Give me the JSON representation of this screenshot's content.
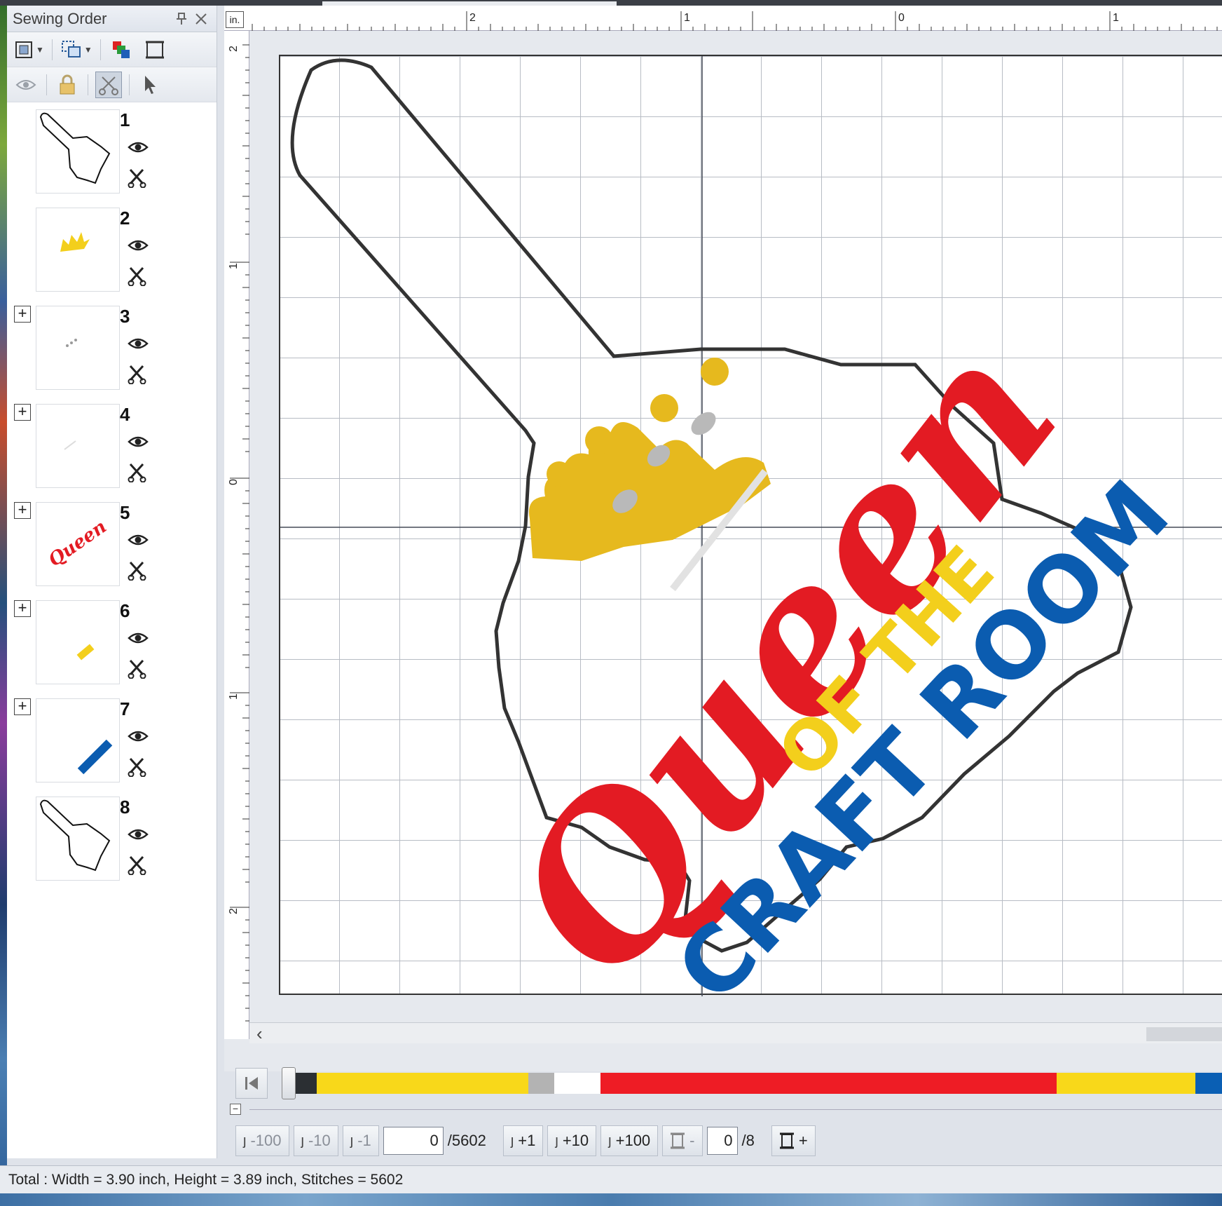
{
  "panel": {
    "title": "Sewing Order",
    "pin_icon": "pin-icon",
    "close_icon": "close-icon",
    "items": [
      {
        "number": "1",
        "thumb": "outline-shape"
      },
      {
        "number": "2",
        "thumb": "crown-small"
      },
      {
        "number": "3",
        "thumb": "gray-dots",
        "expandable": true
      },
      {
        "number": "4",
        "thumb": "white-lines",
        "expandable": true
      },
      {
        "number": "5",
        "thumb": "queen-red",
        "expandable": true
      },
      {
        "number": "6",
        "thumb": "of-the-yellow",
        "expandable": true
      },
      {
        "number": "7",
        "thumb": "craft-room-blue",
        "expandable": true
      },
      {
        "number": "8",
        "thumb": "outline-shape"
      }
    ],
    "expand_symbol": "+"
  },
  "ruler": {
    "unit": "in.",
    "top_labels": [
      "2",
      "1",
      "0",
      "1"
    ],
    "left_labels": [
      "2",
      "1",
      "0",
      "1",
      "2"
    ]
  },
  "design": {
    "text_queen": "Queen",
    "text_of_the": "OF THE",
    "text_craft_room": "CRAFT ROOM"
  },
  "timeline": {
    "segments": [
      {
        "color": "#2b2f33",
        "weight": 4
      },
      {
        "color": "#f8d81a",
        "weight": 32
      },
      {
        "color": "#b3b3b3",
        "weight": 4
      },
      {
        "color": "#ffffff",
        "weight": 7
      },
      {
        "color": "#ee1c25",
        "weight": 69
      },
      {
        "color": "#f8d81a",
        "weight": 21
      },
      {
        "color": "#0a5fb4",
        "weight": 4
      }
    ]
  },
  "stitch_nav": {
    "minus100": "-100",
    "minus10": "-10",
    "minus1": "-1",
    "stitch_value": "0",
    "stitch_total": "/5602",
    "plus1": "+1",
    "plus10": "+10",
    "plus100": "+100",
    "frame_minus": "-",
    "color_value": "0",
    "color_total": "/8",
    "frame_plus": "+"
  },
  "status": {
    "text": "Total : Width = 3.90 inch, Height = 3.89 inch, Stitches = 5602"
  },
  "colors": {
    "red": "#e31b23",
    "yellow": "#f3cf1c",
    "gold": "#e6b91e",
    "blue": "#0b5cb0",
    "silver": "#b9b9b9"
  }
}
